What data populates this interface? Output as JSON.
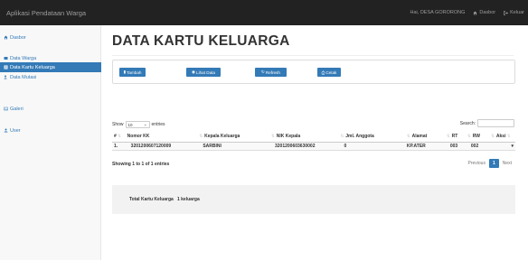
{
  "app": {
    "title": "Aplikasi Pendataan Warga"
  },
  "topnav": {
    "user": "Hai, DESA GORORONG",
    "dasbor": "Dasbor",
    "keluar": "Keluar"
  },
  "sidebar": {
    "items": [
      {
        "label": "Dasbor",
        "icon": "home-icon"
      },
      {
        "label": "Data Warga",
        "icon": "card-icon"
      },
      {
        "label": "Data Kartu Keluarga",
        "icon": "list-icon"
      },
      {
        "label": "Data Mutasi",
        "icon": "transfer-icon"
      },
      {
        "label": "Galeri",
        "icon": "image-icon"
      },
      {
        "label": "User",
        "icon": "user-icon"
      }
    ]
  },
  "page": {
    "title": "DATA KARTU KELUARGA"
  },
  "toolbar": {
    "tambah": "Tambah",
    "lihat_data": "Lihat Data",
    "refresh": "Refresh",
    "cetak": "Cetak"
  },
  "table_controls": {
    "show_label": "Show",
    "show_value": "10",
    "entries_label": "entries",
    "search_label": "Search:"
  },
  "table": {
    "headers": [
      "#",
      "Nomor KK",
      "Kepala Keluarga",
      "NIK Kepala",
      "Jml. Anggota",
      "Alamat",
      "RT",
      "RW",
      "Aksi"
    ],
    "rows": [
      [
        "1.",
        "3201200607120009",
        "SARBINI",
        "3201200603630002",
        "0",
        "KP.ATER",
        "003",
        "002",
        ""
      ]
    ]
  },
  "table_info": "Showing 1 to 1 of 1 entries",
  "pagination": {
    "previous": "Previous",
    "current": "1",
    "next": "Next"
  },
  "summary": {
    "label": "Total Kartu Keluarga",
    "value": "1 keluarga"
  },
  "colors": {
    "primary": "#337ab7",
    "topbar": "#222222"
  }
}
